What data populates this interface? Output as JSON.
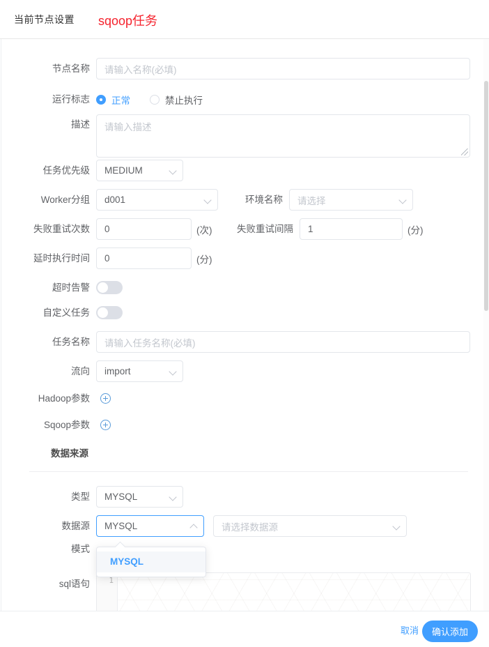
{
  "header": {
    "title": "当前节点设置",
    "task_type": "sqoop任务",
    "task_type_color": "#f5222d"
  },
  "form": {
    "node_name": {
      "label": "节点名称",
      "placeholder": "请输入名称(必填)",
      "value": ""
    },
    "run_flag": {
      "label": "运行标志",
      "options": [
        {
          "label": "正常",
          "selected": true
        },
        {
          "label": "禁止执行",
          "selected": false
        }
      ]
    },
    "description": {
      "label": "描述",
      "placeholder": "请输入描述",
      "value": ""
    },
    "task_priority": {
      "label": "任务优先级",
      "value": "MEDIUM"
    },
    "worker_group": {
      "label": "Worker分组",
      "value": "d001"
    },
    "environment_name": {
      "label": "环境名称",
      "placeholder": "请选择",
      "value": ""
    },
    "failed_retry_times": {
      "label": "失败重试次数",
      "value": "0",
      "unit": "(次)"
    },
    "failed_retry_interval": {
      "label": "失败重试间隔",
      "value": "1",
      "unit": "(分)"
    },
    "delay_execution_time": {
      "label": "延时执行时间",
      "value": "0",
      "unit": "(分)"
    },
    "timeout_alarm": {
      "label": "超时告警",
      "enabled": false
    },
    "custom_task": {
      "label": "自定义任务",
      "enabled": false
    },
    "task_name": {
      "label": "任务名称",
      "placeholder": "请输入任务名称(必填)",
      "value": ""
    },
    "flow_direction": {
      "label": "流向",
      "value": "import"
    },
    "hadoop_params": {
      "label": "Hadoop参数",
      "add_icon": "plus-circle-icon"
    },
    "sqoop_params": {
      "label": "Sqoop参数",
      "add_icon": "plus-circle-icon"
    }
  },
  "data_source_section": {
    "title": "数据来源",
    "type": {
      "label": "类型",
      "value": "MYSQL"
    },
    "datasource": {
      "label": "数据源",
      "value": "MYSQL",
      "focused": true,
      "picker_placeholder": "请选择数据源",
      "picker_value": ""
    },
    "mode": {
      "label": "模式"
    },
    "sql_statement": {
      "label": "sql语句",
      "line_number": "1",
      "value": ""
    }
  },
  "dropdown": {
    "open": true,
    "options": [
      {
        "label": "MYSQL",
        "selected": true
      }
    ]
  },
  "footer": {
    "cancel_label": "取消",
    "confirm_label": "确认添加",
    "confirm_color": "#409eff"
  }
}
